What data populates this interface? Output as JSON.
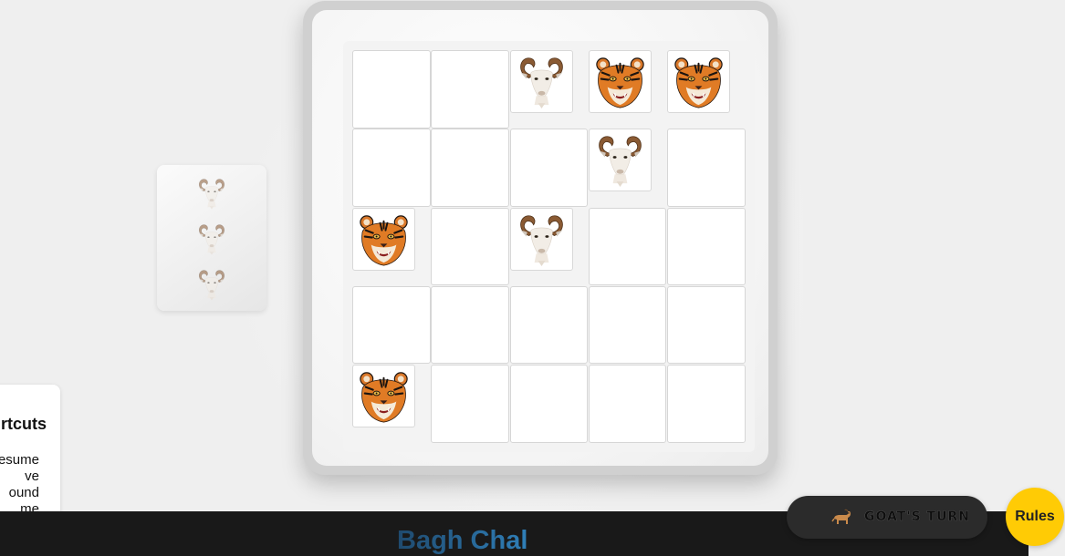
{
  "game": {
    "title": "Bagh Chal",
    "turn_label": "GOAT'S TURN",
    "rules_label": "Rules"
  },
  "shortcuts": {
    "title": "rtcuts",
    "items": [
      "esume",
      "ve",
      "ound",
      "me"
    ]
  },
  "reserve": {
    "goats_remaining": 3,
    "goat_icon": "goat-icon"
  },
  "board": {
    "size": 5,
    "pieces": [
      {
        "row": 0,
        "col": 2,
        "type": "goat"
      },
      {
        "row": 0,
        "col": 3,
        "type": "tiger"
      },
      {
        "row": 0,
        "col": 4,
        "type": "tiger"
      },
      {
        "row": 1,
        "col": 3,
        "type": "goat"
      },
      {
        "row": 2,
        "col": 0,
        "type": "tiger"
      },
      {
        "row": 2,
        "col": 2,
        "type": "goat"
      },
      {
        "row": 4,
        "col": 0,
        "type": "tiger"
      }
    ]
  },
  "colors": {
    "accent_rules": "#ffcb05",
    "title_gradient_start": "#1f4a6e",
    "title_gradient_end": "#2f7fb8",
    "footer_bg": "#191919",
    "turn_bg": "#2b2b2b"
  }
}
